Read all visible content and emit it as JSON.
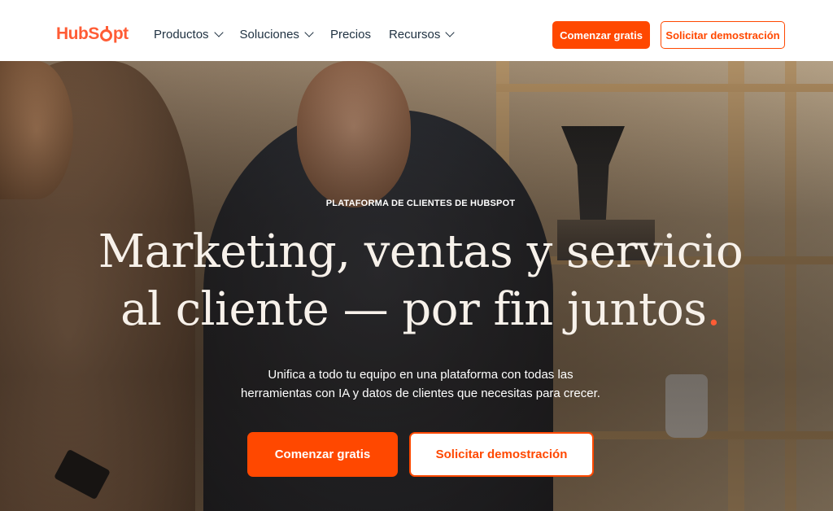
{
  "nav": {
    "logo_text_1": "Hub",
    "logo_text_2": "pt",
    "menu": [
      {
        "label": "Productos",
        "has_dropdown": true
      },
      {
        "label": "Soluciones",
        "has_dropdown": true
      },
      {
        "label": "Precios",
        "has_dropdown": false
      },
      {
        "label": "Recursos",
        "has_dropdown": true
      }
    ],
    "cta_primary": "Comenzar gratis",
    "cta_secondary": "Solicitar demostración"
  },
  "hero": {
    "eyebrow": "PLATAFORMA DE CLIENTES DE HUBSPOT",
    "headline_line1": "Marketing, ventas y servicio",
    "headline_line2": "al cliente — por fin juntos",
    "headline_dot": ".",
    "sub_line1": "Unifica a todo tu equipo en una plataforma con todas las",
    "sub_line2": "herramientas con IA y datos de clientes que necesitas para crecer.",
    "cta_primary": "Comenzar gratis",
    "cta_secondary": "Solicitar demostración"
  },
  "colors": {
    "brand": "#ff4800",
    "logo": "#ff5c35",
    "nav_text": "#213343"
  }
}
